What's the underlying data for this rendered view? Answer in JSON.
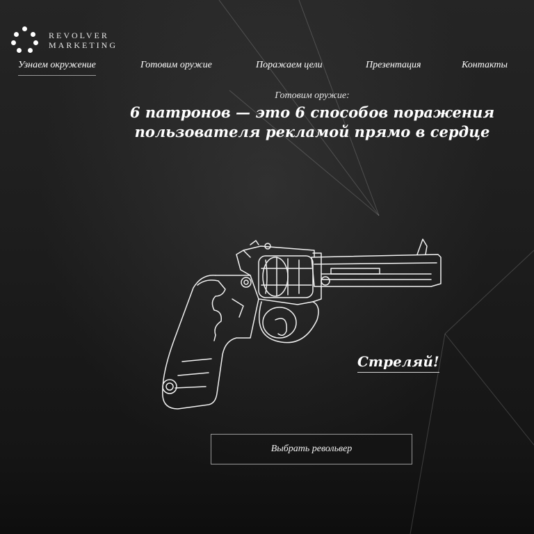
{
  "brand": {
    "line1": "REVOLVER",
    "line2": "MARKETING"
  },
  "nav": {
    "items": [
      {
        "label": "Узнаем окружение"
      },
      {
        "label": "Готовим оружие"
      },
      {
        "label": "Поражаем цели"
      },
      {
        "label": "Презентация"
      },
      {
        "label": "Контакты"
      }
    ],
    "active_index": 0
  },
  "hero": {
    "subtitle": "Готовим оружие:",
    "headline_line1": "6 патронов — это 6 способов поражения",
    "headline_line2": "пользователя рекламой прямо в сердце"
  },
  "actions": {
    "shoot_label": "Стреляй!",
    "choose_label": "Выбрать револьвер"
  },
  "icons": {
    "logo": "dots-logo-icon",
    "gun": "revolver-illustration"
  },
  "colors": {
    "background": "#1c1c1c",
    "text": "#ffffff",
    "button_border": "#9a9a9a"
  }
}
